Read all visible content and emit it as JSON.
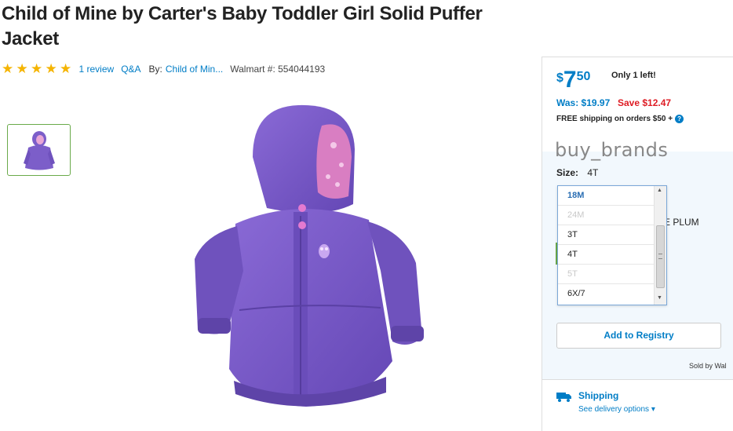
{
  "product": {
    "title": "Child of Mine by Carter's Baby Toddler Girl Solid Puffer Jacket",
    "review_link": "1 review",
    "qa_link": "Q&A",
    "by_label": "By:",
    "brand_link": "Child of Min...",
    "walmart_number": "Walmart #: 554044193",
    "rating": 5
  },
  "offer": {
    "currency": "$",
    "price_dollars": "7",
    "price_cents": "50",
    "stock_note": "Only 1 left!",
    "was_price": "Was: $19.97",
    "save_amount": "Save $12.47",
    "shipping_note": "FREE shipping on orders $50 +",
    "help_icon": "?"
  },
  "overlay_text": "buy_brands",
  "size": {
    "label": "Size:",
    "value": "4T",
    "options": [
      {
        "label": "18M",
        "state": "selected"
      },
      {
        "label": "24M",
        "state": "disabled"
      },
      {
        "label": "3T",
        "state": "normal"
      },
      {
        "label": "4T",
        "state": "normal"
      },
      {
        "label": "5T",
        "state": "disabled"
      },
      {
        "label": "6X/7",
        "state": "normal"
      }
    ]
  },
  "color_partial": "E PLUM",
  "actions": {
    "registry": "Add to Registry",
    "sold_by": "Sold by Wal"
  },
  "shipping": {
    "label": "Shipping",
    "delivery_link": "See delivery options",
    "chevron": "▾"
  },
  "icons": [
    "star-icon",
    "question-icon",
    "truck-icon",
    "chevron-down-icon",
    "scroll-up-icon",
    "scroll-down-icon"
  ],
  "colors": {
    "accent": "#007dc6",
    "save_red": "#de1c24",
    "star": "#f5b400",
    "jacket": "#7c5ec9"
  }
}
